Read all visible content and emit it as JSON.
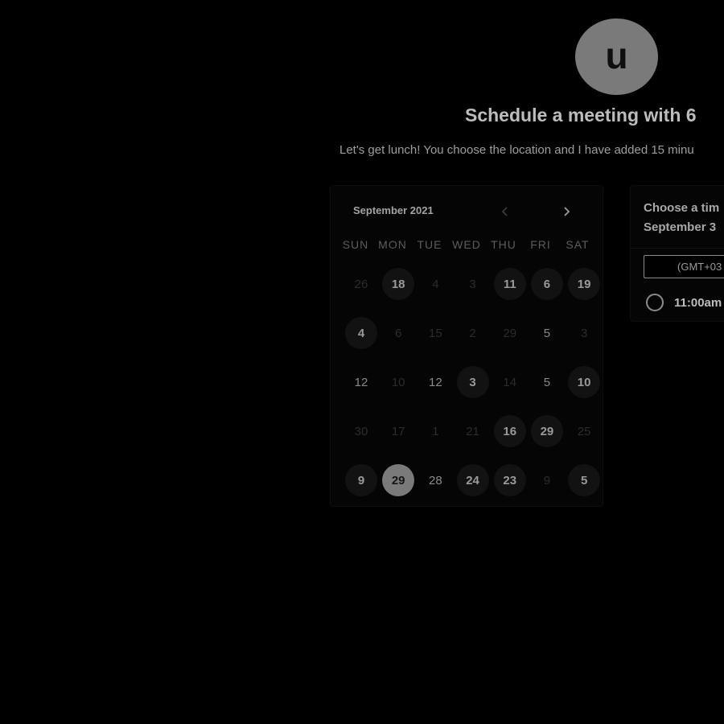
{
  "host": {
    "avatar_initial": "u"
  },
  "header": {
    "title": "Schedule a meeting with 6",
    "subtitle": "Let's get lunch! You choose the location and I have added 15 minu"
  },
  "calendar": {
    "month_label": "September 2021",
    "prev_icon": "chevron-left-icon",
    "next_icon": "chevron-right-icon",
    "weekdays": [
      "SUN",
      "MON",
      "TUE",
      "WED",
      "THU",
      "FRI",
      "SAT"
    ],
    "weeks": [
      [
        {
          "d": "26",
          "s": "dim"
        },
        {
          "d": "18",
          "s": "avail"
        },
        {
          "d": "4",
          "s": "dim"
        },
        {
          "d": "3",
          "s": "dim"
        },
        {
          "d": "11",
          "s": "avail"
        },
        {
          "d": "6",
          "s": "avail"
        },
        {
          "d": "19",
          "s": "avail"
        }
      ],
      [
        {
          "d": "4",
          "s": "avail"
        },
        {
          "d": "6",
          "s": "dim"
        },
        {
          "d": "15",
          "s": "dim"
        },
        {
          "d": "2",
          "s": "dim"
        },
        {
          "d": "29",
          "s": "dim"
        },
        {
          "d": "5",
          "s": "plain"
        },
        {
          "d": "3",
          "s": "dim"
        }
      ],
      [
        {
          "d": "12",
          "s": "plain"
        },
        {
          "d": "10",
          "s": "dim"
        },
        {
          "d": "12",
          "s": "plain"
        },
        {
          "d": "3",
          "s": "avail"
        },
        {
          "d": "14",
          "s": "dim"
        },
        {
          "d": "5",
          "s": "plain"
        },
        {
          "d": "10",
          "s": "avail"
        }
      ],
      [
        {
          "d": "30",
          "s": "dim"
        },
        {
          "d": "17",
          "s": "dim"
        },
        {
          "d": "1",
          "s": "dim"
        },
        {
          "d": "21",
          "s": "dim"
        },
        {
          "d": "16",
          "s": "avail"
        },
        {
          "d": "29",
          "s": "avail"
        },
        {
          "d": "25",
          "s": "dim"
        }
      ],
      [
        {
          "d": "9",
          "s": "avail"
        },
        {
          "d": "29",
          "s": "selected"
        },
        {
          "d": "28",
          "s": "plain"
        },
        {
          "d": "24",
          "s": "avail"
        },
        {
          "d": "23",
          "s": "avail"
        },
        {
          "d": "9",
          "s": "dim"
        },
        {
          "d": "5",
          "s": "avail"
        }
      ]
    ]
  },
  "time_panel": {
    "heading_line1": "Choose a tim",
    "heading_line2": "September 3",
    "timezone_value": "(GMT+03",
    "slots": [
      {
        "label": "11:00am"
      }
    ]
  },
  "colors": {
    "background": "#000000",
    "selected_day": "#7a7a7a",
    "avatar": "#7a7a7a"
  }
}
